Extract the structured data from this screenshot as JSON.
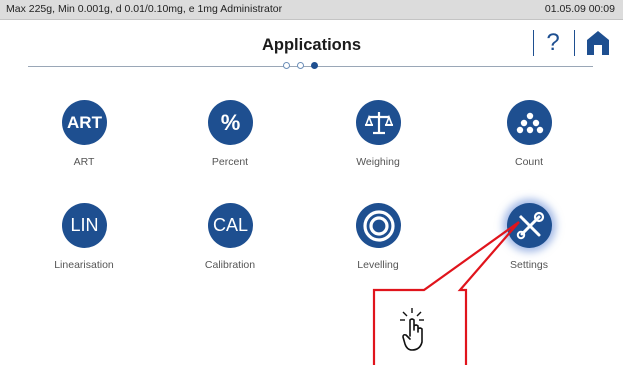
{
  "status": {
    "left": "Max 225g, Min 0.001g, d 0.01/0.10mg, e 1mg  Administrator",
    "right": "01.05.09 00:09"
  },
  "header": {
    "title": "Applications",
    "help_label": "?",
    "pager": {
      "pages": 3,
      "current": 3
    }
  },
  "apps": [
    {
      "id": "art",
      "glyph": "ART",
      "label": "ART"
    },
    {
      "id": "percent",
      "glyph": "%",
      "label": "Percent"
    },
    {
      "id": "weighing",
      "glyph": "balance-scale-icon",
      "label": "Weighing"
    },
    {
      "id": "count",
      "glyph": "dots-icon",
      "label": "Count"
    },
    {
      "id": "linearisation",
      "glyph": "LIN",
      "label": "Linearisation"
    },
    {
      "id": "calibration",
      "glyph": "CAL",
      "label": "Calibration"
    },
    {
      "id": "levelling",
      "glyph": "level-ring-icon",
      "label": "Levelling"
    },
    {
      "id": "settings",
      "glyph": "wrench-screwdriver-icon",
      "label": "Settings"
    }
  ],
  "colors": {
    "accent": "#1e4f90",
    "callout": "#e0141c",
    "status_bar": "#dcdcdc"
  },
  "callout": {
    "icon": "tap-hand-icon",
    "target": "settings"
  }
}
